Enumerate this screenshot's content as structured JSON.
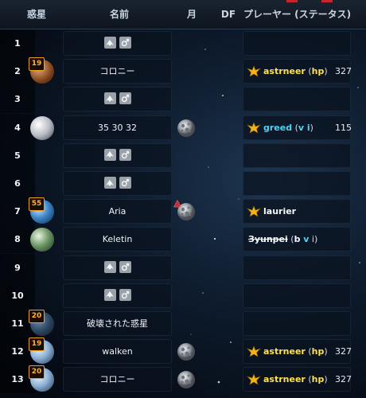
{
  "header": {
    "col_planet": "惑星",
    "col_name": "名前",
    "col_moon": "月",
    "col_df": "DF",
    "col_player": "プレーヤー (ステータス)"
  },
  "colors": {
    "alliance_yellow": "#ffe14a",
    "status_cyan": "#4fd3f0",
    "badge_orange": "#f0a020",
    "inactive_red": "#c8242c"
  },
  "rows": [
    {
      "pos": "1",
      "name": "",
      "has_planet": false,
      "actions": [
        "fleet-icon",
        "male-symbol-icon"
      ],
      "moon": false
    },
    {
      "pos": "2",
      "name": "コロニー",
      "has_planet": true,
      "planet_style": "brown",
      "badge": "19",
      "moon": false,
      "player": {
        "name": "astrneer",
        "status_open": " (",
        "status": "hp",
        "status_close": ")",
        "points": "327",
        "name_color": "yellow",
        "rank_icon": "rank-wings-icon"
      }
    },
    {
      "pos": "3",
      "name": "",
      "has_planet": false,
      "actions": [
        "fleet-icon",
        "male-symbol-icon"
      ],
      "moon": false
    },
    {
      "pos": "4",
      "name": "35 30 32",
      "has_planet": true,
      "planet_style": "white",
      "moon": true,
      "player": {
        "name": "greed",
        "status_open": " (",
        "status": "v",
        "status_mid": " i",
        "status_close": ")",
        "points": "115",
        "name_color": "cyan",
        "rank_icon": "rank-wings-icon"
      }
    },
    {
      "pos": "5",
      "name": "",
      "has_planet": false,
      "actions": [
        "fleet-icon",
        "male-symbol-icon"
      ],
      "moon": false
    },
    {
      "pos": "6",
      "name": "",
      "has_planet": false,
      "actions": [
        "fleet-icon",
        "male-symbol-icon"
      ],
      "moon": false
    },
    {
      "pos": "7",
      "name": "Aria",
      "has_planet": true,
      "planet_style": "earth",
      "badge": "55",
      "moon": true,
      "moon_alert": true,
      "player": {
        "name": "laurier",
        "points": "",
        "name_color": "white",
        "rank_icon": "rank-wings-icon"
      }
    },
    {
      "pos": "8",
      "name": "Keletin",
      "has_planet": true,
      "planet_style": "green",
      "moon": false,
      "player": {
        "name": "Зyunpei",
        "status_open": " (",
        "status": "b",
        "status_mid": " v",
        "status_tail": " i",
        "status_close": ")",
        "points": "",
        "name_color": "white",
        "struck": true
      }
    },
    {
      "pos": "9",
      "name": "",
      "has_planet": false,
      "actions": [
        "fleet-icon",
        "male-symbol-icon"
      ],
      "moon": false
    },
    {
      "pos": "10",
      "name": "",
      "has_planet": false,
      "actions": [
        "fleet-icon",
        "male-symbol-icon"
      ],
      "moon": false
    },
    {
      "pos": "11",
      "name": "破壊された惑星",
      "has_planet": true,
      "planet_style": "destroyed",
      "badge": "20",
      "moon": false
    },
    {
      "pos": "12",
      "name": "walken",
      "has_planet": true,
      "planet_style": "blue",
      "badge": "19",
      "moon": true,
      "player": {
        "name": "astrneer",
        "status_open": " (",
        "status": "hp",
        "status_close": ")",
        "points": "327",
        "name_color": "yellow",
        "rank_icon": "rank-wings-icon"
      }
    },
    {
      "pos": "13",
      "name": "コロニー",
      "has_planet": true,
      "planet_style": "blue",
      "badge": "20",
      "moon": true,
      "player": {
        "name": "astrneer",
        "status_open": " (",
        "status": "hp",
        "status_close": ")",
        "points": "327",
        "name_color": "yellow",
        "rank_icon": "rank-wings-icon"
      }
    }
  ]
}
